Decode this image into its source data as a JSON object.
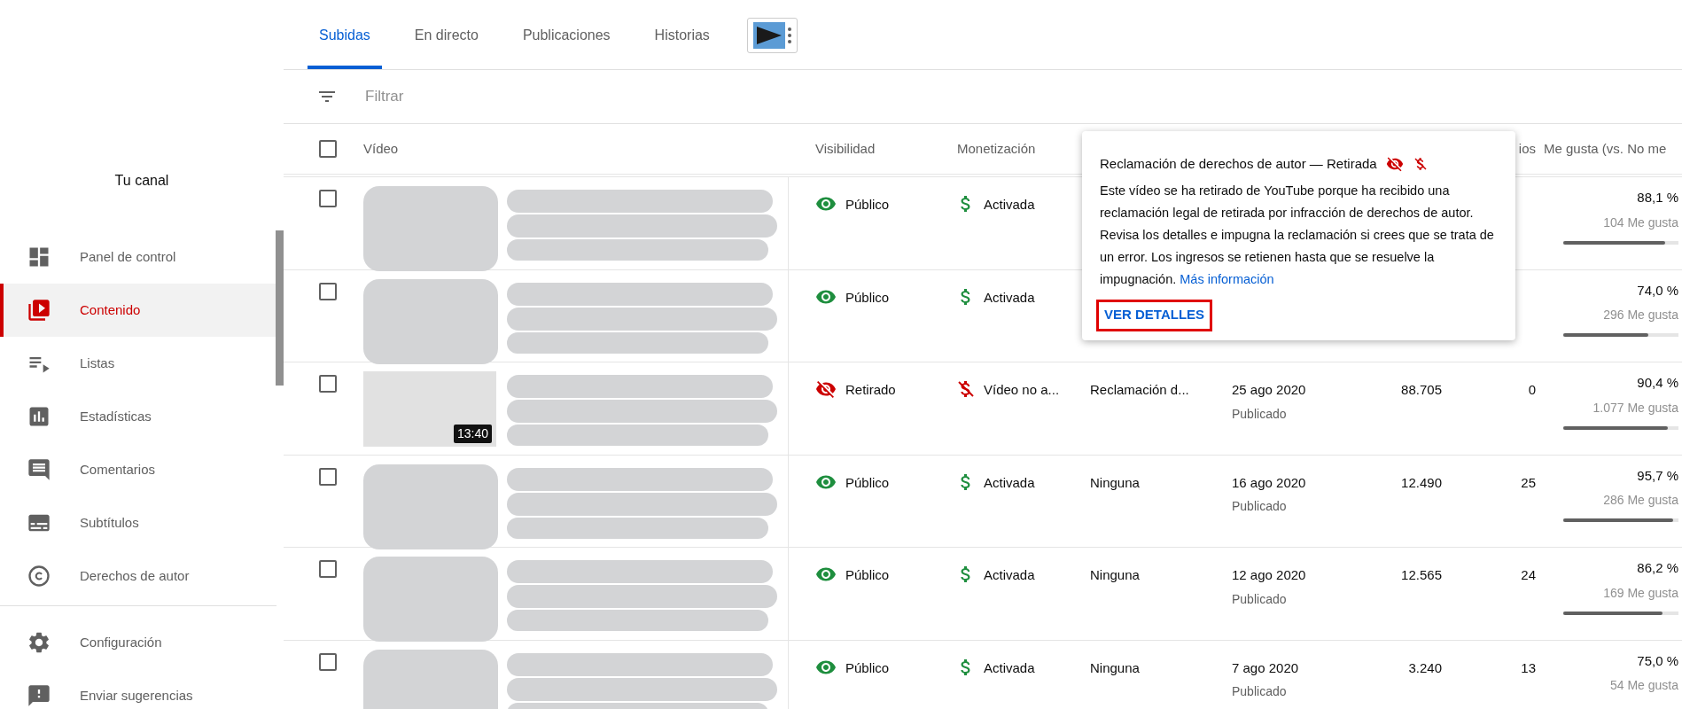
{
  "sidebar": {
    "channel_label": "Tu canal",
    "items": [
      {
        "label": "Panel de control",
        "selected": false
      },
      {
        "label": "Contenido",
        "selected": true
      },
      {
        "label": "Listas",
        "selected": false
      },
      {
        "label": "Estadísticas",
        "selected": false
      },
      {
        "label": "Comentarios",
        "selected": false
      },
      {
        "label": "Subtítulos",
        "selected": false
      },
      {
        "label": "Derechos de autor",
        "selected": false
      }
    ],
    "footer_items": [
      {
        "label": "Configuración",
        "selected": false
      },
      {
        "label": "Enviar sugerencias",
        "selected": false
      }
    ]
  },
  "tabs": [
    {
      "label": "Subidas",
      "selected": true
    },
    {
      "label": "En directo",
      "selected": false
    },
    {
      "label": "Publicaciones",
      "selected": false
    },
    {
      "label": "Historias",
      "selected": false
    }
  ],
  "filter": {
    "placeholder": "Filtrar"
  },
  "table": {
    "select_all_checked": false,
    "columns": [
      "Vídeo",
      "Visibilidad",
      "Monetización",
      "ios",
      "Me gusta (vs. No me"
    ],
    "rows": [
      {
        "checked": false,
        "thumbnail": {
          "kind": "redacted"
        },
        "visibility": {
          "kind": "public",
          "label": "Público"
        },
        "monetization": {
          "kind": "on",
          "label": "Activada"
        },
        "likes": "88,1 %",
        "likes_count": "104 Me gusta",
        "level": 0.881
      },
      {
        "checked": false,
        "thumbnail": {
          "kind": "redacted"
        },
        "visibility": {
          "kind": "public",
          "label": "Público"
        },
        "monetization": {
          "kind": "on",
          "label": "Activada"
        },
        "likes": "74,0 %",
        "likes_count": "296 Me gusta",
        "level": 0.74
      },
      {
        "checked": false,
        "thumbnail": {
          "kind": "blank",
          "duration": "13:40"
        },
        "visibility": {
          "kind": "removed",
          "label": "Retirado"
        },
        "monetization": {
          "kind": "off",
          "label": "Vídeo no a..."
        },
        "restrictions": "Reclamación d...",
        "date": "25 ago 2020",
        "date_status": "Publicado",
        "views": "88.705",
        "comments": "0",
        "likes": "90,4 %",
        "likes_count": "1.077 Me gusta",
        "level": 0.904
      },
      {
        "checked": false,
        "thumbnail": {
          "kind": "redacted"
        },
        "visibility": {
          "kind": "public",
          "label": "Público"
        },
        "monetization": {
          "kind": "on",
          "label": "Activada"
        },
        "restrictions": "Ninguna",
        "date": "16 ago 2020",
        "date_status": "Publicado",
        "views": "12.490",
        "comments": "25",
        "likes": "95,7 %",
        "likes_count": "286 Me gusta",
        "level": 0.957
      },
      {
        "checked": false,
        "thumbnail": {
          "kind": "redacted"
        },
        "visibility": {
          "kind": "public",
          "label": "Público"
        },
        "monetization": {
          "kind": "on",
          "label": "Activada"
        },
        "restrictions": "Ninguna",
        "date": "12 ago 2020",
        "date_status": "Publicado",
        "views": "12.565",
        "comments": "24",
        "likes": "86,2 %",
        "likes_count": "169 Me gusta",
        "level": 0.862
      },
      {
        "checked": false,
        "thumbnail": {
          "kind": "redacted"
        },
        "visibility": {
          "kind": "public",
          "label": "Público"
        },
        "monetization": {
          "kind": "on",
          "label": "Activada"
        },
        "restrictions": "Ninguna",
        "date": "7 ago 2020",
        "date_status": "Publicado",
        "views": "3.240",
        "comments": "13",
        "likes": "75,0 %",
        "likes_count": "54 Me gusta"
      }
    ]
  },
  "tooltip": {
    "title": "Reclamación de derechos de autor — Retirada",
    "paragraphs": [
      "Este vídeo se ha retirado de YouTube porque ha recibido una reclamación legal de retirada por infracción de derechos de autor.",
      "Revisa los detalles e impugna la reclamación si crees que se trata de un error. Los ingresos se retienen hasta que se resuelve la impugnación."
    ],
    "link": "Más información",
    "button": {
      "label": "VER DETALLES",
      "highlighted": true
    }
  }
}
